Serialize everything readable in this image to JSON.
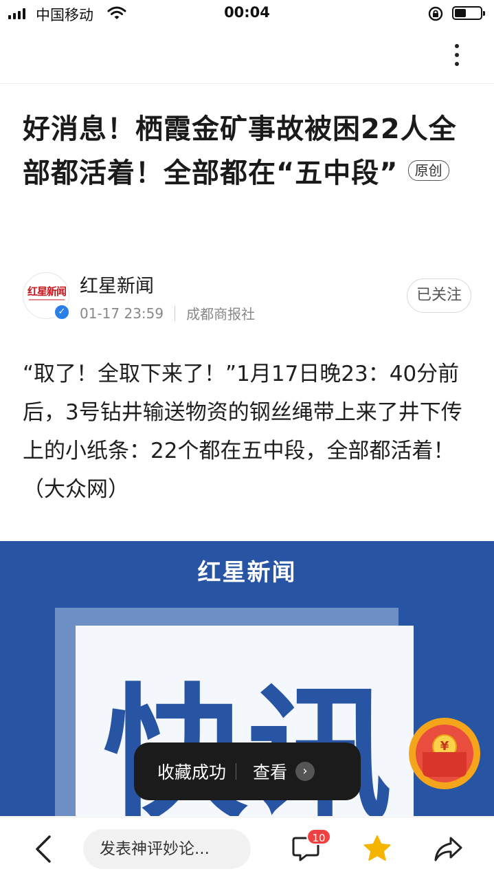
{
  "status_bar": {
    "carrier": "中国移动",
    "time": "00:04",
    "battery_level": 0.45
  },
  "article": {
    "title": "好消息！栖霞金矿事故被困22人全部都活着！全部都在“五中段”",
    "badge": "原创",
    "author": {
      "name": "红星新闻",
      "avatar_text": "红星新闻",
      "verified": true,
      "datetime": "01-17 23:59",
      "source": "成都商报社",
      "follow_label": "已关注"
    },
    "body": "“取了！全取下来了！”1月17日晚23：40分前后，3号钻井输送物资的钢丝绳带上来了井下传上的小纸条：22个都在五中段，全部都活着！（大众网）",
    "image": {
      "brand": "红星新闻",
      "chars": [
        "快",
        "讯"
      ]
    }
  },
  "toast": {
    "message": "收藏成功",
    "action": "查看"
  },
  "floating": {
    "icon": "red-packet-icon",
    "coin_symbol": "¥"
  },
  "bottom_bar": {
    "comment_placeholder": "发表神评妙论...",
    "comment_count": "10",
    "icons": [
      "back-icon",
      "comment-icon",
      "star-icon",
      "share-icon"
    ],
    "favorited": true
  },
  "colors": {
    "accent_blue": "#2754a3",
    "badge_red": "#f04142",
    "star_gold": "#f5b400"
  }
}
